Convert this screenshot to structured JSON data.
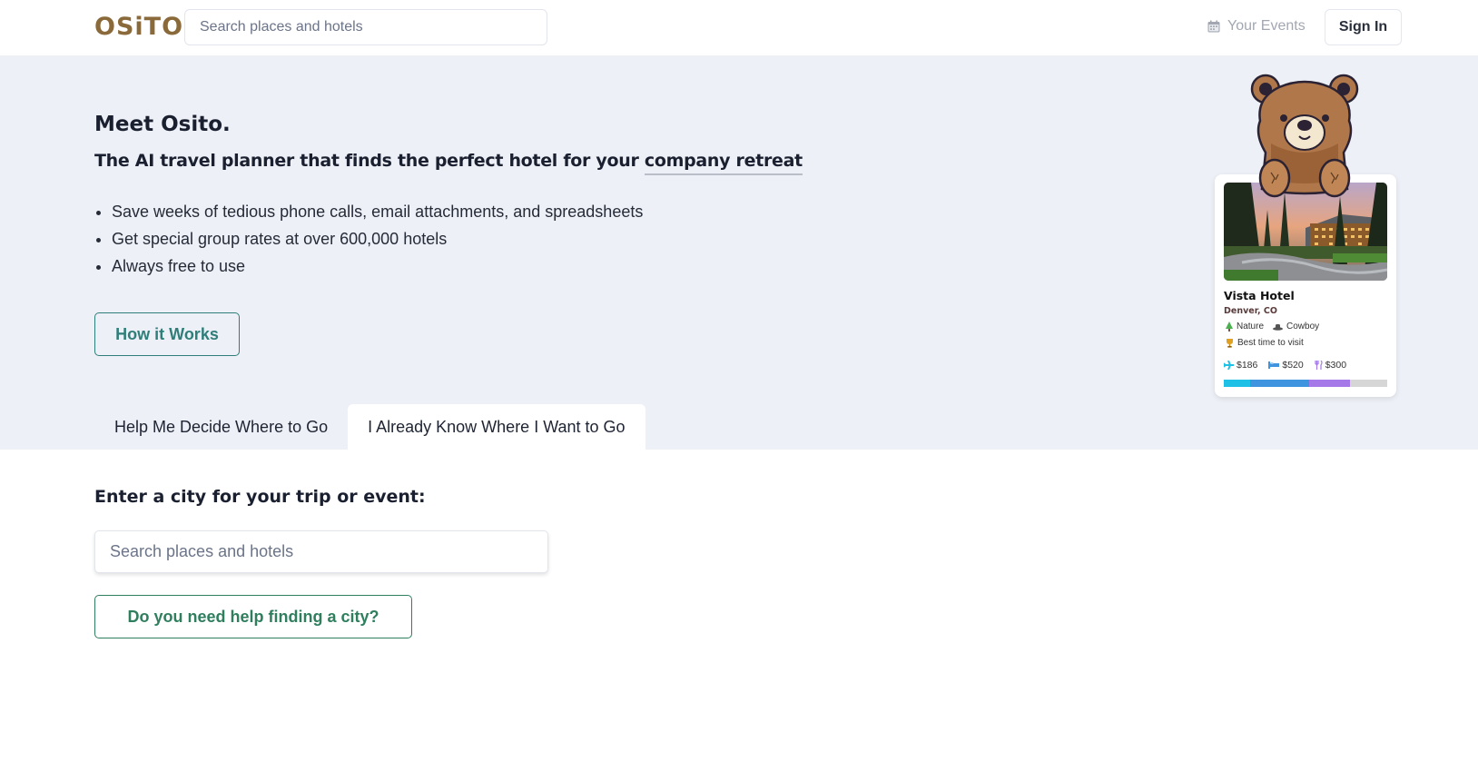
{
  "header": {
    "logo": "OSiTO",
    "search_placeholder": "Search places and hotels",
    "your_events_label": "Your Events",
    "sign_in_label": "Sign In"
  },
  "hero": {
    "title": "Meet Osito.",
    "subtitle_prefix": "The AI travel planner that finds the perfect hotel for your ",
    "subtitle_highlight": "company retreat",
    "bullets": [
      "Save weeks of tedious phone calls, email attachments, and spreadsheets",
      "Get special group rates at over 600,000 hotels",
      "Always free to use"
    ],
    "how_it_works_label": "How it Works"
  },
  "tabs": [
    {
      "label": "Help Me Decide Where to Go",
      "active": false
    },
    {
      "label": "I Already Know Where I Want to Go",
      "active": true
    }
  ],
  "hotel_card": {
    "name": "Vista Hotel",
    "city": "Denver, CO",
    "tags": [
      {
        "icon": "tree-icon",
        "label": "Nature"
      },
      {
        "icon": "cowboy-hat-icon",
        "label": "Cowboy"
      }
    ],
    "best_time": {
      "icon": "trophy-icon",
      "label": "Best time to visit"
    },
    "prices": [
      {
        "icon": "plane-icon",
        "label": "$186",
        "value": 186,
        "color": "#1fc0e6"
      },
      {
        "icon": "bed-icon",
        "label": "$520",
        "value": 520,
        "color": "#3f94e0"
      },
      {
        "icon": "fork-knife-icon",
        "label": "$300",
        "value": 300,
        "color": "#a57ae8"
      }
    ],
    "bar_fill_fractions": [
      0.16,
      0.36,
      0.25
    ],
    "bar_remainder_color": "#d6d6d6"
  },
  "trip": {
    "city_label": "Enter a city for your trip or event:",
    "search_placeholder": "Search places and hotels",
    "help_button_label": "Do you need help finding a city?"
  },
  "colors": {
    "brand": "#8a6a3a",
    "accent_teal": "#2f7e79",
    "accent_green": "#2f7e5e",
    "hero_bg": "#edf0f6"
  }
}
